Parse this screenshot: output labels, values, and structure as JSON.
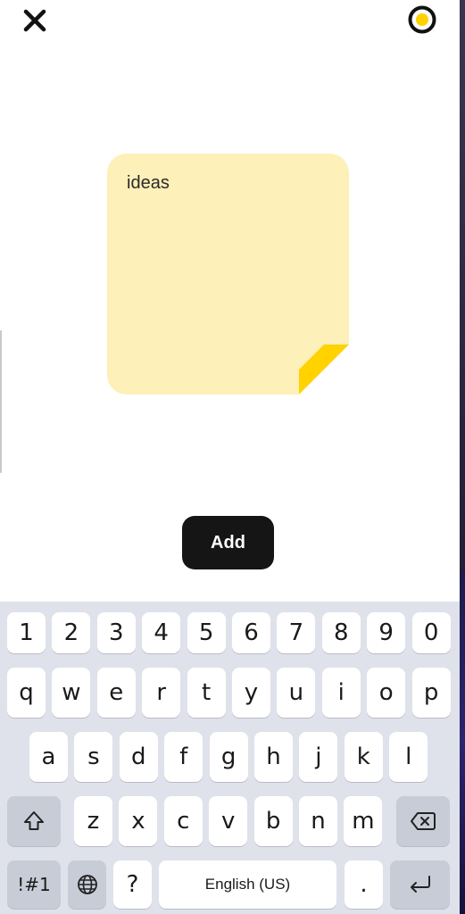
{
  "header": {
    "close_icon": "close-icon",
    "color_picker_icon": "color-dot-icon",
    "accent_color": "#FFD200"
  },
  "note": {
    "text": "ideas",
    "background_color": "#FDF0B8",
    "fold_color": "#FFD200"
  },
  "add_button": {
    "label": "Add",
    "color": "#151515"
  },
  "keyboard": {
    "number_row": [
      "1",
      "2",
      "3",
      "4",
      "5",
      "6",
      "7",
      "8",
      "9",
      "0"
    ],
    "row1": [
      "q",
      "w",
      "e",
      "r",
      "t",
      "y",
      "u",
      "i",
      "o",
      "p"
    ],
    "row2": [
      "a",
      "s",
      "d",
      "f",
      "g",
      "h",
      "j",
      "k",
      "l"
    ],
    "row3": [
      "z",
      "x",
      "c",
      "v",
      "b",
      "n",
      "m"
    ],
    "shift_icon": "shift-icon",
    "backspace_icon": "backspace-icon",
    "symbols_label": "!#1",
    "globe_icon": "globe-icon",
    "question_label": "?",
    "space_label": "English (US)",
    "period_label": ".",
    "enter_icon": "enter-icon"
  }
}
